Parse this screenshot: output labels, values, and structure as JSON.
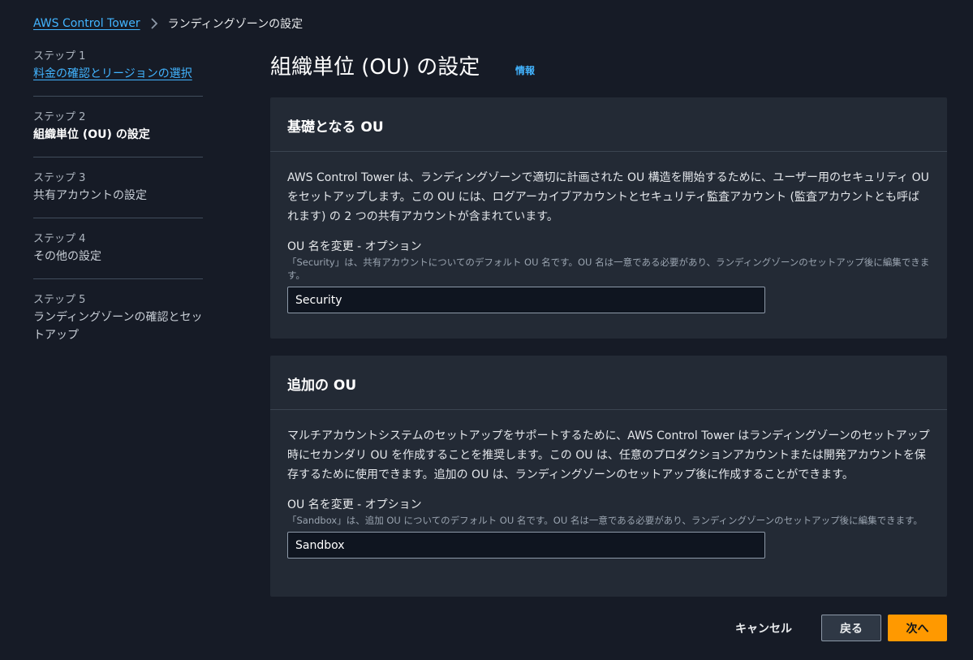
{
  "breadcrumb": {
    "root": "AWS Control Tower",
    "current": "ランディングゾーンの設定"
  },
  "steps": [
    {
      "number": "ステップ 1",
      "title": "料金の確認とリージョンの選択",
      "state": "link"
    },
    {
      "number": "ステップ 2",
      "title": "組織単位 (OU) の設定",
      "state": "active"
    },
    {
      "number": "ステップ 3",
      "title": "共有アカウントの設定",
      "state": "disabled"
    },
    {
      "number": "ステップ 4",
      "title": "その他の設定",
      "state": "disabled"
    },
    {
      "number": "ステップ 5",
      "title": "ランディングゾーンの確認とセットアップ",
      "state": "disabled"
    }
  ],
  "header": {
    "title": "組織単位 (OU) の設定",
    "info": "情報"
  },
  "foundational": {
    "title": "基礎となる OU",
    "description": "AWS Control Tower は、ランディングゾーンで適切に計画された OU 構造を開始するために、ユーザー用のセキュリティ OU をセットアップします。この OU には、ログアーカイブアカウントとセキュリティ監査アカウント (監査アカウントとも呼ばれます) の 2 つの共有アカウントが含まれています。",
    "field_label": "OU 名を変更 - オプション",
    "field_hint": "「Security」は、共有アカウントについてのデフォルト OU 名です。OU 名は一意である必要があり、ランディングゾーンのセットアップ後に編集できます。",
    "value": "Security"
  },
  "additional": {
    "title": "追加の OU",
    "description": "マルチアカウントシステムのセットアップをサポートするために、AWS Control Tower はランディングゾーンのセットアップ時にセカンダリ OU を作成することを推奨します。この OU は、任意のプロダクションアカウントまたは開発アカウントを保存するために使用できます。追加の OU は、ランディングゾーンのセットアップ後に作成することができます。",
    "field_label": "OU 名を変更 - オプション",
    "field_hint": "「Sandbox」は、追加 OU についてのデフォルト OU 名です。OU 名は一意である必要があり、ランディングゾーンのセットアップ後に編集できます。",
    "value": "Sandbox"
  },
  "footer": {
    "cancel": "キャンセル",
    "back": "戻る",
    "next": "次へ"
  },
  "colors": {
    "background": "#161b26",
    "panel": "#232a35",
    "link": "#42b4ff",
    "primary": "#ff9900"
  },
  "icons": {
    "breadcrumb_separator": "chevron-right-icon"
  }
}
